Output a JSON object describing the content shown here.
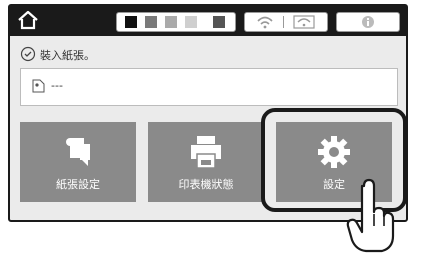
{
  "topbar": {
    "home_icon": "home-icon",
    "ink_levels": [
      1.0,
      0.7,
      0.45,
      0.55
    ],
    "ink_colors": [
      "#111111",
      "#7a7a7a",
      "#aaaaaa",
      "#cfcfcf"
    ],
    "wifi_icons": [
      "wifi-direct-icon",
      "wifi-icon"
    ],
    "info_icon": "info-icon"
  },
  "status": {
    "icon": "check-circle-icon",
    "text": "裝入紙張。"
  },
  "paper": {
    "icon": "paper-source-icon",
    "text": "---"
  },
  "tiles": [
    {
      "label": "紙張設定",
      "icon": "paper-setting-icon"
    },
    {
      "label": "印表機狀態",
      "icon": "printer-status-icon"
    },
    {
      "label": "設定",
      "icon": "gear-icon"
    }
  ],
  "colors": {
    "tile_bg": "#8a8a8a",
    "panel_bg": "#ebebeb",
    "bar_bg": "#1a1a1a"
  }
}
